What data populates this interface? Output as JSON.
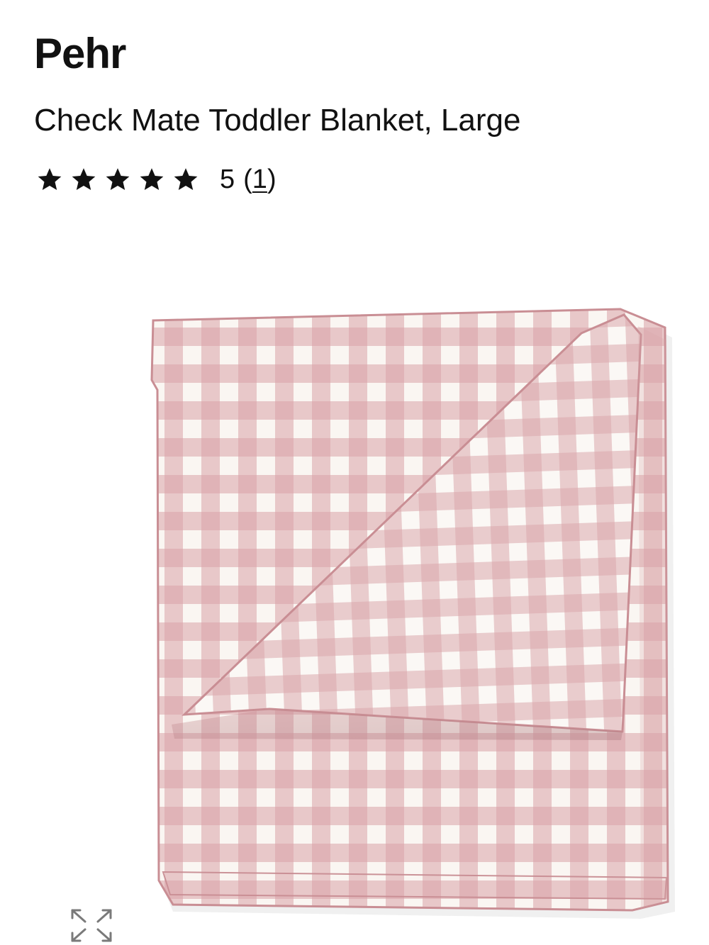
{
  "product": {
    "brand": "Pehr",
    "title": "Check Mate Toddler Blanket, Large",
    "rating": {
      "value": 5,
      "max": 5,
      "display": "5",
      "review_count": "1",
      "open_paren": "(",
      "close_paren": ")"
    },
    "image": {
      "icon": "gingham-blanket-image",
      "colors": {
        "pink": "#d9a2a8",
        "cream": "#faf6f2",
        "edge": "#c98e94"
      }
    },
    "expand_icon": "expand-arrows-icon"
  }
}
